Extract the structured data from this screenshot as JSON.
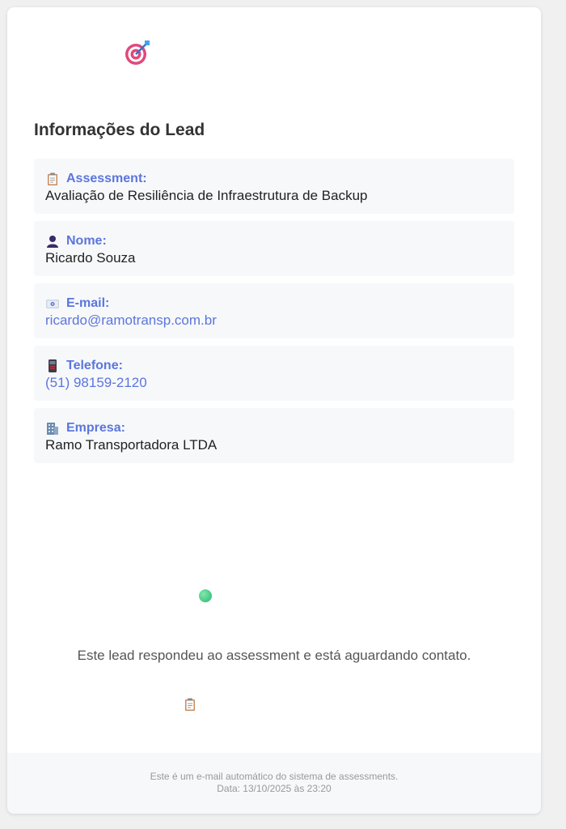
{
  "header": {
    "icon": "target-dart-icon"
  },
  "title": "Informações do Lead",
  "fields": [
    {
      "icon": "clipboard-icon",
      "label": "Assessment:",
      "value": "Avaliação de Resiliência de Infraestrutura de Backup"
    },
    {
      "icon": "person-icon",
      "label": "Nome:",
      "value": "Ricardo Souza"
    },
    {
      "icon": "email-icon",
      "label": "E-mail:",
      "value": "ricardo@ramotransp.com.br"
    },
    {
      "icon": "phone-icon",
      "label": "Telefone:",
      "value": "(51) 98159-2120"
    },
    {
      "icon": "building-icon",
      "label": "Empresa:",
      "value": "Ramo Transportadora LTDA"
    }
  ],
  "status": {
    "icon": "green-circle-icon",
    "message": "Este lead respondeu ao assessment e está aguardando contato."
  },
  "action_icon": "clipboard-icon",
  "footer": {
    "line1": "Este é um e-mail automático do sistema de assessments.",
    "line2": "Data: 13/10/2025 às 23:20"
  },
  "colors": {
    "accent": "#5b76dd",
    "field_bg": "#f7f8fa",
    "status_green": "#2bb673"
  }
}
